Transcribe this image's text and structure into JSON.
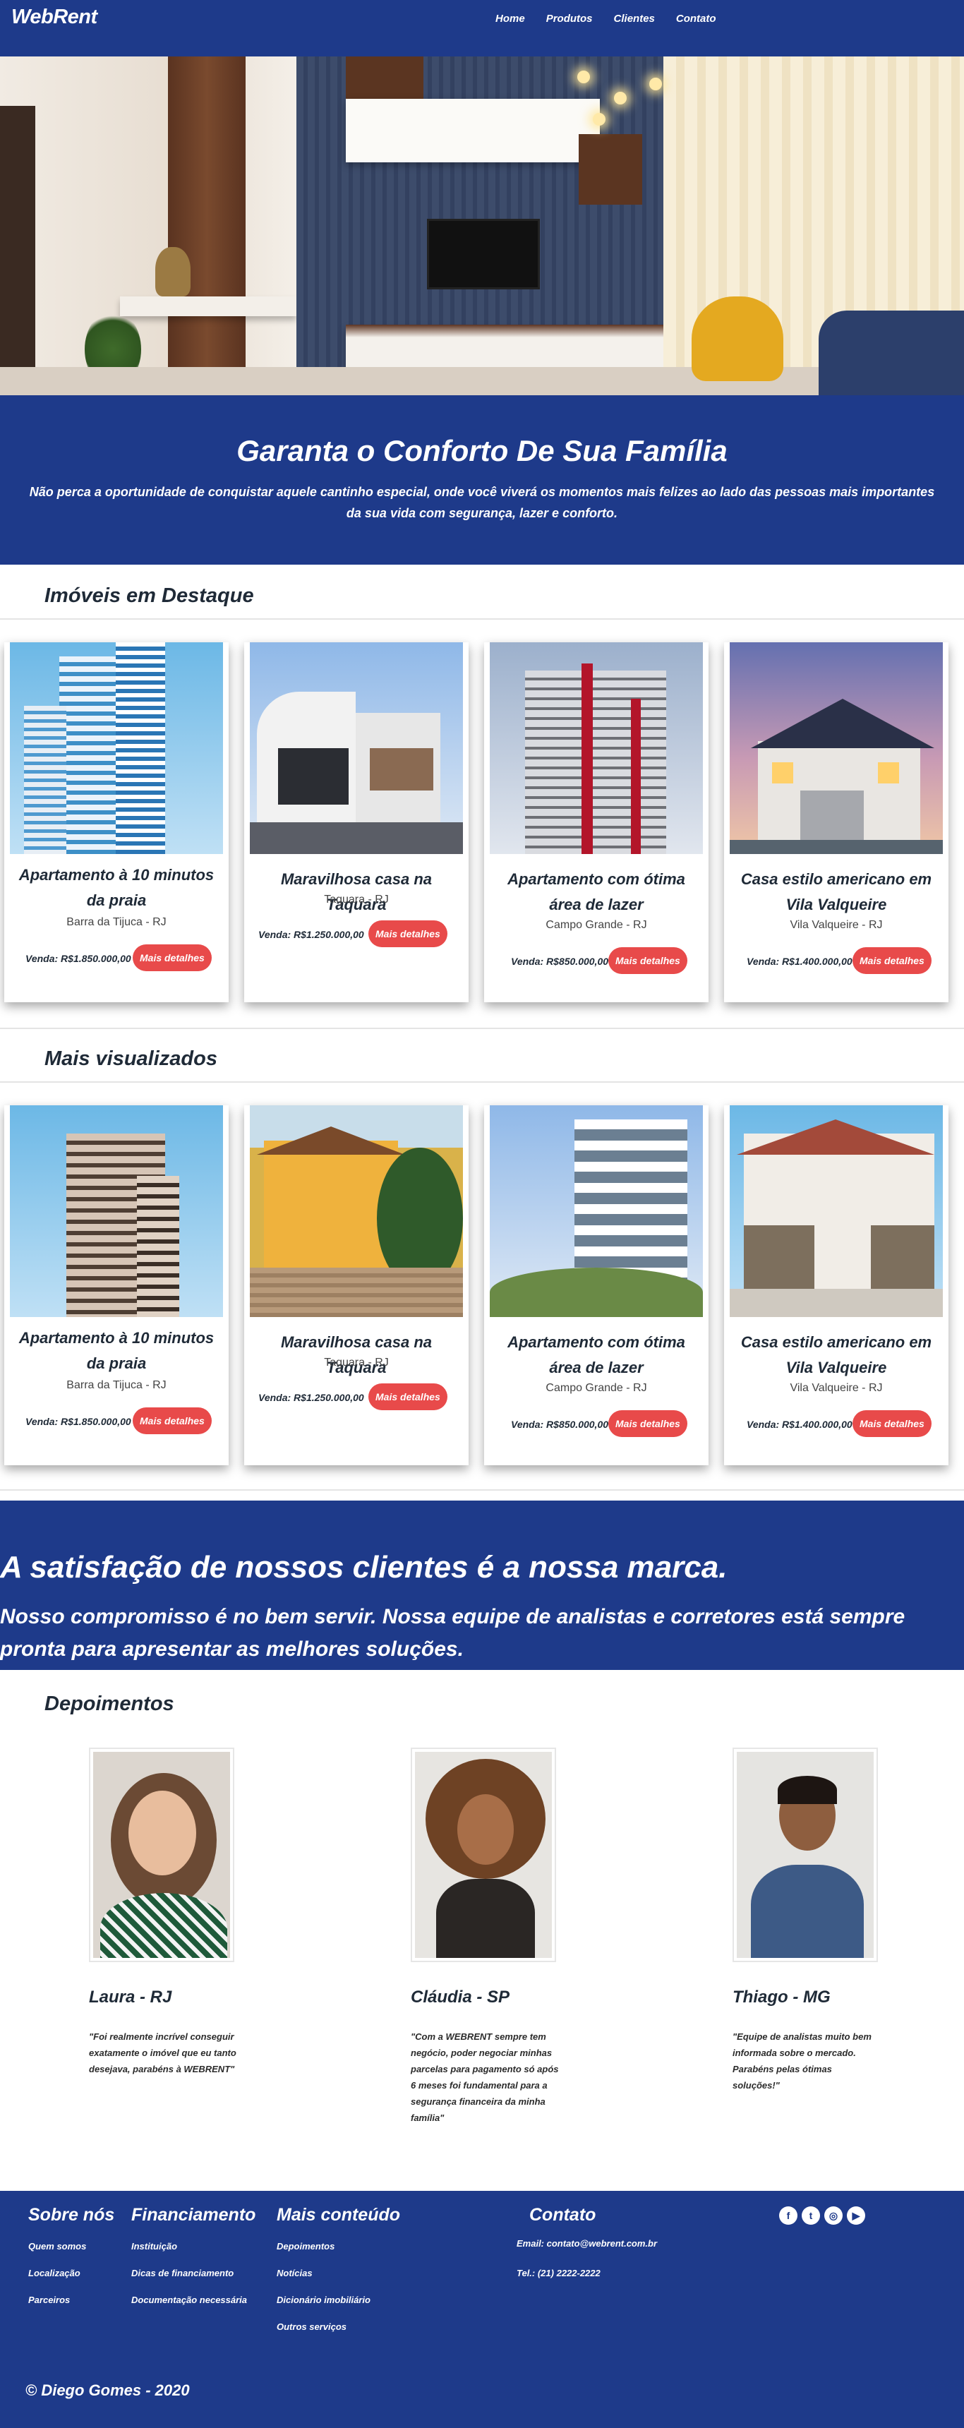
{
  "nav": {
    "brand": "WebRent",
    "items": [
      "Home",
      "Produtos",
      "Clientes",
      "Contato"
    ]
  },
  "banner": {
    "title": "Garanta o Conforto De Sua Família",
    "text": "Não perca a oportunidade de conquistar aquele cantinho especial, onde você viverá os momentos mais felizes ao lado das pessoas mais importantes da sua vida com segurança, lazer e conforto."
  },
  "featured": {
    "title": "Imóveis em Destaque",
    "cards": [
      {
        "title": "Apartamento à 10 minutos da praia",
        "location": "Barra da Tijuca - RJ",
        "price": "Venda: R$1.850.000,00",
        "button": "Mais detalhes"
      },
      {
        "title": "Maravilhosa casa na Taquara",
        "location": "Taquara - RJ",
        "price": "Venda: R$1.250.000,00",
        "button": "Mais detalhes"
      },
      {
        "title": "Apartamento com ótima área de lazer",
        "location": "Campo Grande - RJ",
        "price": "Venda: R$850.000,00",
        "button": "Mais detalhes"
      },
      {
        "title": "Casa estilo americano em Vila Valqueire",
        "location": "Vila Valqueire - RJ",
        "price": "Venda: R$1.400.000,00",
        "button": "Mais detalhes"
      }
    ]
  },
  "most_viewed": {
    "title": "Mais visualizados",
    "cards": [
      {
        "title": "Apartamento à 10 minutos da praia",
        "location": "Barra da Tijuca - RJ",
        "price": "Venda: R$1.850.000,00",
        "button": "Mais detalhes"
      },
      {
        "title": "Maravilhosa casa na Taquara",
        "location": "Taquara - RJ",
        "price": "Venda: R$1.250.000,00",
        "button": "Mais detalhes"
      },
      {
        "title": "Apartamento com ótima área de lazer",
        "location": "Campo Grande - RJ",
        "price": "Venda: R$850.000,00",
        "button": "Mais detalhes"
      },
      {
        "title": "Casa estilo americano em Vila Valqueire",
        "location": "Vila Valqueire - RJ",
        "price": "Venda: R$1.400.000,00",
        "button": "Mais detalhes"
      }
    ]
  },
  "satisfaction": {
    "title": "A satisfação de nossos clientes é a nossa marca.",
    "text": "Nosso compromisso é no bem servir. Nossa equipe de analistas e corretores está sempre pronta para apresentar as melhores soluções."
  },
  "testimonials": {
    "title": "Depoimentos",
    "items": [
      {
        "name": "Laura - RJ",
        "quote": "\"Foi realmente incrível conseguir exatamente o imóvel que eu tanto desejava, parabéns à WEBRENT\""
      },
      {
        "name": "Cláudia - SP",
        "quote": "\"Com a WEBRENT sempre tem negócio, poder negociar minhas parcelas para pagamento só após 6 meses foi fundamental para a segurança financeira da minha família\""
      },
      {
        "name": "Thiago - MG",
        "quote": "\"Equipe de analistas muito bem informada sobre o mercado. Parabéns pelas ótimas soluções!\""
      }
    ]
  },
  "footer": {
    "about": {
      "title": "Sobre nós",
      "links": [
        "Quem somos",
        "Localização",
        "Parceiros"
      ]
    },
    "financing": {
      "title": "Financiamento",
      "links": [
        "Instituição",
        "Dicas de financiamento",
        "Documentação necessária"
      ]
    },
    "more": {
      "title": "Mais conteúdo",
      "links": [
        "Depoimentos",
        "Notícias",
        "Dicionário imobiliário",
        "Outros serviços"
      ]
    },
    "contact": {
      "title": "Contato",
      "email": "Email: contato@webrent.com.br",
      "phone": "Tel.: (21) 2222-2222"
    },
    "social_icons": [
      "facebook-icon",
      "twitter-icon",
      "instagram-icon",
      "youtube-icon"
    ],
    "copyright": "© Diego Gomes - 2020"
  },
  "colors": {
    "primary": "#1e3a8a",
    "accent": "#e84a4a"
  }
}
